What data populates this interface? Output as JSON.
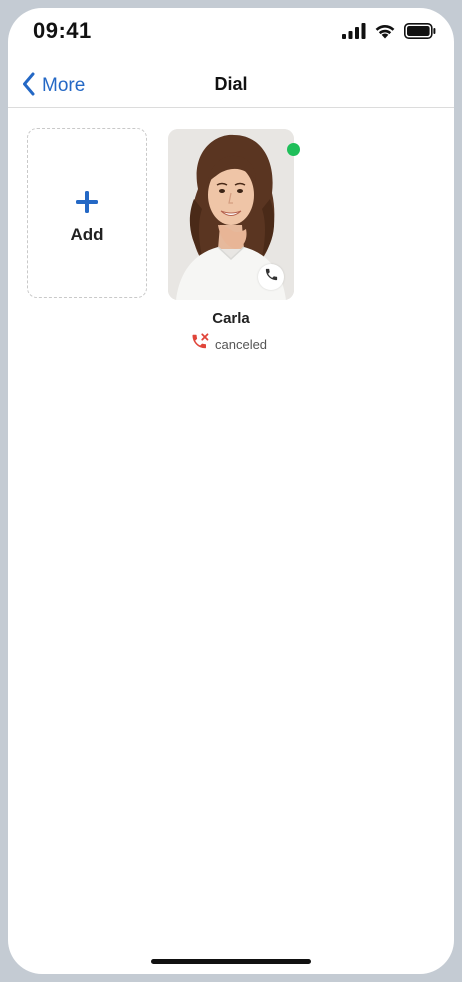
{
  "status_bar": {
    "time": "09:41",
    "icons": [
      "cellular-signal-icon",
      "wifi-icon",
      "battery-icon"
    ]
  },
  "nav": {
    "back_label": "More",
    "back_icon": "chevron-left-icon",
    "title": "Dial",
    "accent_color": "#2468c5"
  },
  "add_tile": {
    "label": "Add",
    "icon": "plus-icon"
  },
  "contact": {
    "name": "Carla",
    "presence": "online",
    "presence_color": "#1fbf5a",
    "call_icon": "phone-icon",
    "call_status_icon": "missed-call-icon",
    "call_status": "canceled",
    "call_status_color": "#e0453a"
  }
}
